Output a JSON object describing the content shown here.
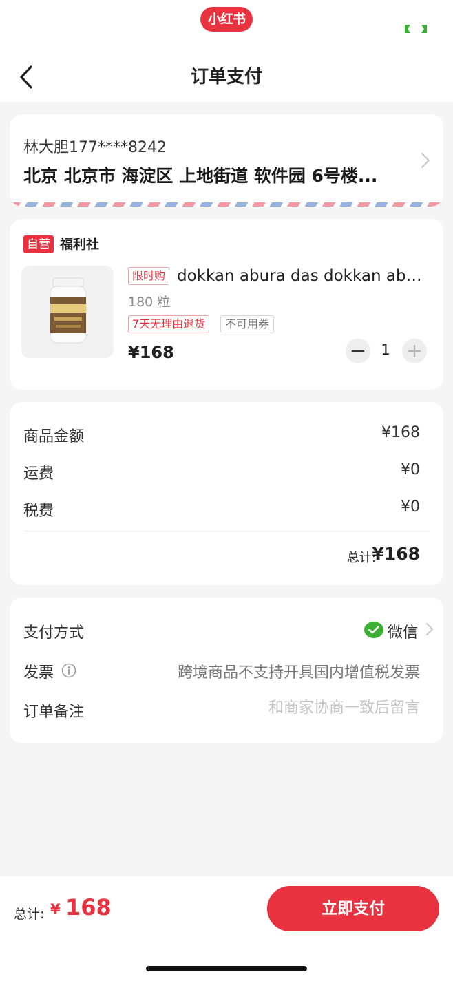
{
  "status": {
    "brand_logo_text": "小红书",
    "icons": [
      "xiaohongshu-logo",
      "green-status-icon"
    ]
  },
  "nav": {
    "title": "订单支付",
    "back_icon": "chevron-left-icon"
  },
  "address": {
    "contact": "林大胆177****8242",
    "line": "北京 北京市 海淀区 上地街道 软件园 6号楼...",
    "chevron_icon": "chevron-right-icon"
  },
  "product": {
    "self_badge": "自营",
    "shop_name": "福利社",
    "promo_tag": "限时购",
    "title": "dokkan abura das dokkan abura...",
    "spec": "180 粒",
    "tags": [
      "7天无理由退货",
      "不可用券"
    ],
    "price": "¥168",
    "quantity": "1"
  },
  "amounts": {
    "rows": [
      {
        "label": "商品金额",
        "value": "¥168"
      },
      {
        "label": "运费",
        "value": "¥0"
      },
      {
        "label": "税费",
        "value": "¥0"
      }
    ],
    "total_label": "总计:",
    "total_value": "¥168"
  },
  "payment": {
    "method_label": "支付方式",
    "method_value": "微信",
    "invoice_label": "发票",
    "invoice_value": "跨境商品不支持开具国内增值税发票",
    "remark_label": "订单备注",
    "remark_placeholder": "和商家协商一致后留言"
  },
  "bottom": {
    "total_label": "总计:",
    "currency": "¥",
    "total_value": "168",
    "pay_button": "立即支付"
  },
  "colors": {
    "accent": "#e8323f",
    "wechat": "#3cb034",
    "background": "#f5f5f5"
  }
}
